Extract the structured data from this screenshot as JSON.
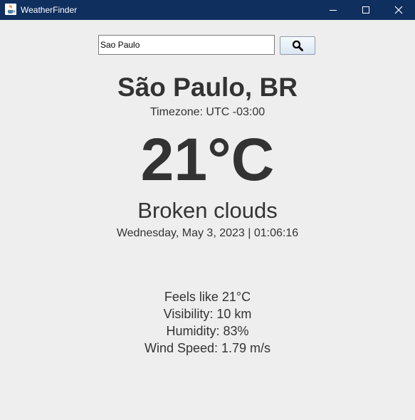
{
  "window": {
    "title": "WeatherFinder",
    "icon": "java-cup-icon"
  },
  "search": {
    "value": "Sao Paulo",
    "button_icon": "search-icon"
  },
  "weather": {
    "city": "São Paulo, BR",
    "timezone": "Timezone: UTC -03:00",
    "temperature": "21°C",
    "condition": "Broken clouds",
    "datetime": "Wednesday, May 3, 2023 | 01:06:16",
    "details": {
      "feels_like": "Feels like 21°C",
      "visibility": "Visibility: 10 km",
      "humidity": "Humidity: 83%",
      "wind_speed": "Wind Speed: 1.79 m/s"
    }
  },
  "colors": {
    "titlebar": "#0f2f5f",
    "background": "#eeeeee",
    "text": "#333333"
  }
}
